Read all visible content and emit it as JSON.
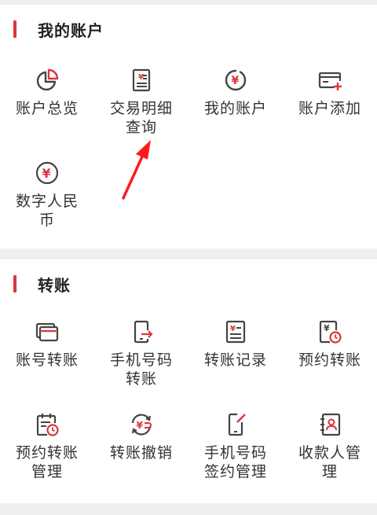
{
  "colors": {
    "accent": "#d9363e",
    "icon_gray": "#444444",
    "background": "#efefef",
    "annotation_arrow": "#ff1a1a"
  },
  "my_account": {
    "title": "我的账户",
    "items": [
      {
        "icon": "pie-chart-icon",
        "line1": "账户总览",
        "line2": ""
      },
      {
        "icon": "receipt-list-icon",
        "line1": "交易明细",
        "line2": "查询"
      },
      {
        "icon": "yen-circle-icon",
        "line1": "我的账户",
        "line2": ""
      },
      {
        "icon": "card-add-icon",
        "line1": "账户添加",
        "line2": ""
      },
      {
        "icon": "digital-yuan-icon",
        "line1": "数字人民",
        "line2": "币"
      }
    ]
  },
  "transfer": {
    "title": "转账",
    "items": [
      {
        "icon": "cards-icon",
        "line1": "账号转账",
        "line2": ""
      },
      {
        "icon": "phone-transfer-icon",
        "line1": "手机号码",
        "line2": "转账"
      },
      {
        "icon": "transfer-record-icon",
        "line1": "转账记录",
        "line2": ""
      },
      {
        "icon": "scheduled-transfer-icon",
        "line1": "预约转账",
        "line2": ""
      },
      {
        "icon": "calendar-clock-icon",
        "line1": "预约转账",
        "line2": "管理"
      },
      {
        "icon": "transfer-revoke-icon",
        "line1": "转账撤销",
        "line2": ""
      },
      {
        "icon": "phone-sign-icon",
        "line1": "手机号码",
        "line2": "签约管理"
      },
      {
        "icon": "payee-icon",
        "line1": "收款人管",
        "line2": "理"
      }
    ]
  }
}
